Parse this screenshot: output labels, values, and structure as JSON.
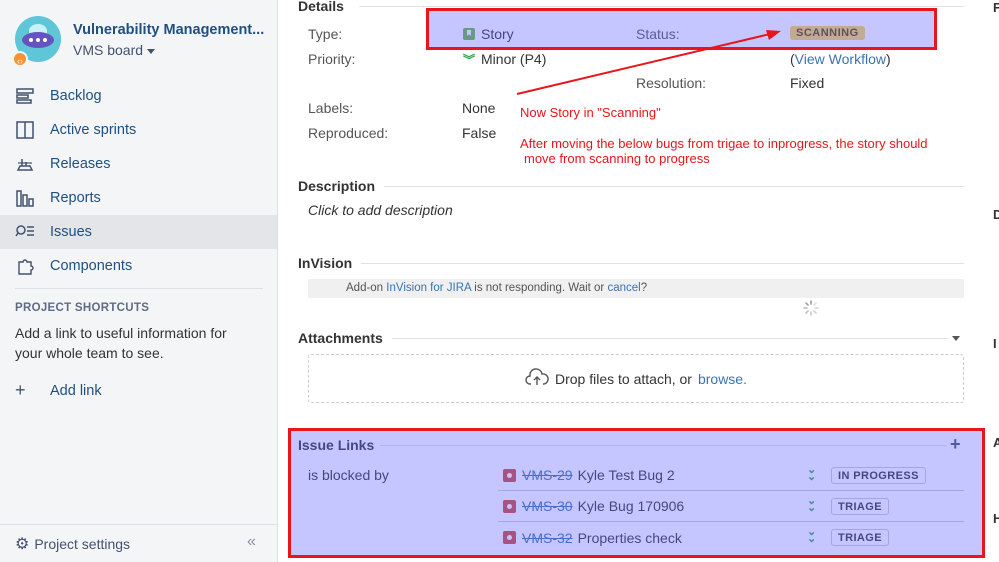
{
  "sidebar": {
    "project_name": "Vulnerability Management...",
    "board_name": "VMS board",
    "nav": [
      {
        "label": "Backlog",
        "icon": "backlog-icon"
      },
      {
        "label": "Active sprints",
        "icon": "active-sprints-icon"
      },
      {
        "label": "Releases",
        "icon": "releases-icon"
      },
      {
        "label": "Reports",
        "icon": "reports-icon"
      },
      {
        "label": "Issues",
        "icon": "issues-icon"
      },
      {
        "label": "Components",
        "icon": "components-icon"
      }
    ],
    "shortcuts_title": "PROJECT SHORTCUTS",
    "shortcuts_text": "Add a link to useful information for your whole team to see.",
    "add_link": "Add link",
    "project_settings": "Project settings"
  },
  "details": {
    "title": "Details",
    "type_label": "Type:",
    "type_value": "Story",
    "status_label": "Status:",
    "status_value": "SCANNING",
    "priority_label": "Priority:",
    "priority_value": "Minor (P4)",
    "workflow_open": "(",
    "workflow_link": "View Workflow",
    "workflow_close": ")",
    "resolution_label": "Resolution:",
    "resolution_value": "Fixed",
    "labels_label": "Labels:",
    "labels_value": "None",
    "reproduced_label": "Reproduced:",
    "reproduced_value": "False"
  },
  "annotations": {
    "note1": "Now Story in \"Scanning\"",
    "note2_line1": "After moving the below bugs from trigae to inprogress, the story should",
    "note2_line2": "move from scanning to progress"
  },
  "description": {
    "title": "Description",
    "placeholder": "Click to add description"
  },
  "invision": {
    "title": "InVision",
    "pre": "Add-on ",
    "link": "InVision for JIRA",
    "mid": " is not responding. Wait or ",
    "cancel": "cancel",
    "post": "?"
  },
  "attachments": {
    "title": "Attachments",
    "drop_text": "Drop files to attach, or",
    "browse": "browse."
  },
  "issue_links": {
    "title": "Issue Links",
    "relation": "is blocked by",
    "items": [
      {
        "key": "VMS-29",
        "summary": "Kyle Test Bug 2",
        "status": "IN PROGRESS"
      },
      {
        "key": "VMS-30",
        "summary": "Kyle Bug 170906",
        "status": "TRIAGE"
      },
      {
        "key": "VMS-32",
        "summary": "Properties check",
        "status": "TRIAGE"
      }
    ]
  },
  "edge_letters": [
    "F",
    "D",
    "I",
    "A",
    "H"
  ],
  "colors": {
    "annotation_red": "#e8151b",
    "highlight_blue": "#6666ff",
    "link_blue": "#3b73af",
    "status_yellow": "#ffd351"
  }
}
